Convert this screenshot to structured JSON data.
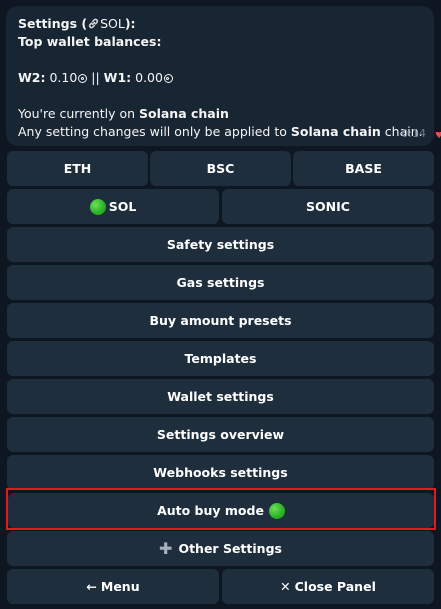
{
  "message": {
    "title_label": "Settings (",
    "title_chain": "SOL",
    "title_end": "):",
    "balances_heading": "Top wallet balances:",
    "w2_label": "W2:",
    "w2_value": " 0.10",
    "separator": " || ",
    "w1_label": "W1:",
    "w1_value": " 0.00",
    "chain_line_prefix": "You're currently on ",
    "chain_name": "Solana chain",
    "apply_line_prefix": "Any setting changes will only be applied to ",
    "apply_chain": "Solana chain",
    "apply_suffix": " chain.",
    "time": "0:14"
  },
  "keyboard": {
    "eth": "ETH",
    "bsc": "BSC",
    "base": "BASE",
    "sol": "SOL",
    "sonic": "SONIC",
    "safety": "Safety settings",
    "gas": "Gas settings",
    "buy_presets": "Buy amount presets",
    "templates": "Templates",
    "wallet": "Wallet settings",
    "overview": "Settings overview",
    "webhooks": "Webhooks settings",
    "auto_buy": "Auto buy mode",
    "other": "Other Settings",
    "menu": "Menu",
    "close": "Close Panel"
  },
  "icons": {
    "link": "link-icon",
    "coin": "coin-icon",
    "green_dot": "green-circle-icon",
    "plus": "plus-icon",
    "back_arrow": "left-arrow-icon",
    "close": "x-icon"
  },
  "colors": {
    "background": "#0e1621",
    "bubble": "#182533",
    "button": "#1f2e3d",
    "highlight": "#e01b22",
    "green": "#2db52a"
  }
}
